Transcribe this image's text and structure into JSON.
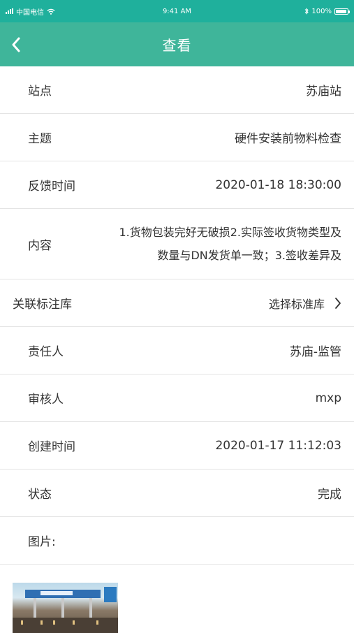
{
  "status_bar": {
    "carrier": "中国电信",
    "time": "9:41 AM",
    "battery": "100%",
    "battery_level": 1.0
  },
  "nav": {
    "title": "查看"
  },
  "rows": [
    {
      "label": "站点",
      "value": "苏庙站"
    },
    {
      "label": "主题",
      "value": "硬件安装前物料检查"
    },
    {
      "label": "反馈时间",
      "value": "2020-01-18 18:30:00"
    },
    {
      "label": "内容",
      "value": "1.货物包装完好无破损2.实际签收货物类型及数量与DN发货单一致；3.签收差异及"
    },
    {
      "label": "关联标注库",
      "value": "选择标准库"
    },
    {
      "label": "责任人",
      "value": "苏庙-监管"
    },
    {
      "label": "审核人",
      "value": "mxp"
    },
    {
      "label": "创建时间",
      "value": "2020-01-17 11:12:03"
    },
    {
      "label": "状态",
      "value": "完成"
    },
    {
      "label": "图片:"
    }
  ],
  "colors": {
    "status_bar": "#1fb09c",
    "nav_bar": "#3fb59a",
    "text": "#333333",
    "divider": "#e4e4e4"
  }
}
